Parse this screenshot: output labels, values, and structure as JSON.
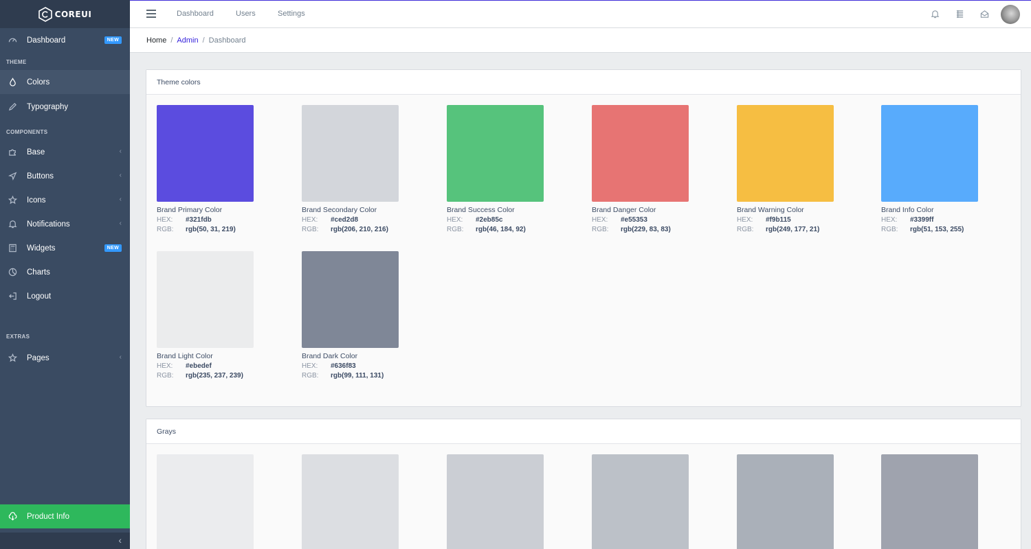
{
  "brand": {
    "name": "COREUI"
  },
  "sidebar": {
    "dashboard": {
      "label": "Dashboard",
      "badge": "NEW"
    },
    "sections": {
      "theme": "THEME",
      "components": "COMPONENTS",
      "extras": "EXTRAS"
    },
    "theme_items": [
      {
        "label": "Colors",
        "icon": "drop-icon"
      },
      {
        "label": "Typography",
        "icon": "pencil-icon"
      }
    ],
    "component_items": [
      {
        "label": "Base",
        "icon": "puzzle-icon"
      },
      {
        "label": "Buttons",
        "icon": "cursor-icon"
      },
      {
        "label": "Icons",
        "icon": "star-icon"
      },
      {
        "label": "Notifications",
        "icon": "bell-icon"
      },
      {
        "label": "Widgets",
        "icon": "calculator-icon",
        "badge": "NEW"
      },
      {
        "label": "Charts",
        "icon": "chart-pie-icon"
      },
      {
        "label": "Logout",
        "icon": "account-logout-icon"
      }
    ],
    "extra_items": [
      {
        "label": "Pages",
        "icon": "star-icon"
      }
    ],
    "footer": {
      "label": "Product Info"
    }
  },
  "header": {
    "links": [
      "Dashboard",
      "Users",
      "Settings"
    ]
  },
  "breadcrumb": {
    "home": "Home",
    "admin": "Admin",
    "current": "Dashboard"
  },
  "theme_colors": {
    "title": "Theme colors",
    "hex_label": "HEX:",
    "rgb_label": "RGB:",
    "swatches": [
      {
        "name": "Brand Primary Color",
        "hex": "#321fdb",
        "rgb": "rgb(50, 31, 219)",
        "color": "#5b4cdf"
      },
      {
        "name": "Brand Secondary Color",
        "hex": "#ced2d8",
        "rgb": "rgb(206, 210, 216)",
        "color": "#d3d6db"
      },
      {
        "name": "Brand Success Color",
        "hex": "#2eb85c",
        "rgb": "rgb(46, 184, 92)",
        "color": "#56c37c"
      },
      {
        "name": "Brand Danger Color",
        "hex": "#e55353",
        "rgb": "rgb(229, 83, 83)",
        "color": "#e77473"
      },
      {
        "name": "Brand Warning Color",
        "hex": "#f9b115",
        "rgb": "rgb(249, 177, 21)",
        "color": "#f6be42"
      },
      {
        "name": "Brand Info Color",
        "hex": "#3399ff",
        "rgb": "rgb(51, 153, 255)",
        "color": "#58abfc"
      },
      {
        "name": "Brand Light Color",
        "hex": "#ebedef",
        "rgb": "rgb(235, 237, 239)",
        "color": "#ebeced"
      },
      {
        "name": "Brand Dark Color",
        "hex": "#636f83",
        "rgb": "rgb(99, 111, 131)",
        "color": "#7f8797"
      }
    ]
  },
  "grays": {
    "title": "Grays",
    "swatches": [
      {
        "color": "#ebecee"
      },
      {
        "color": "#dcdee2"
      },
      {
        "color": "#cbced4"
      },
      {
        "color": "#bcc1c8"
      },
      {
        "color": "#aab0b9"
      },
      {
        "color": "#9fa3ae"
      }
    ]
  }
}
